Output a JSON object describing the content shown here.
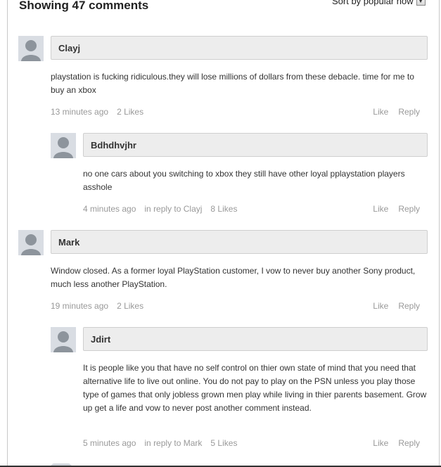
{
  "header": {
    "title": "Showing 47 comments",
    "sort_label": "Sort by popular now",
    "sort_icon": "chevron-down-icon"
  },
  "comments": [
    {
      "author": "Clayj",
      "text": "playstation is fucking ridiculous.they will lose millions of dollars from these debacle. time for me to buy an xbox",
      "time": "13 minutes ago",
      "in_reply_to": "",
      "likes": "2 Likes",
      "like_label": "Like",
      "reply_label": "Reply"
    },
    {
      "author": "Bdhdhvjhr",
      "text": "no one cars about you switching to xbox they still have other loyal pplaystation players asshole",
      "time": "4 minutes ago",
      "in_reply_to": "in reply to Clayj",
      "likes": "8 Likes",
      "like_label": "Like",
      "reply_label": "Reply"
    },
    {
      "author": "Mark",
      "text": "Window closed. As a former loyal PlayStation customer, I vow to never buy another Sony product, much less another PlayStation.",
      "time": "19 minutes ago",
      "in_reply_to": "",
      "likes": "2 Likes",
      "like_label": "Like",
      "reply_label": "Reply"
    },
    {
      "author": "Jdirt",
      "text": "It is people like you that have no self control on thier own state of mind that you need that alternative life to live out online. You do not pay to play on the PSN unless you play those type of games that only jobless grown men play while living in thier parents basement. Grow up get a life and vow to never post another comment instead.",
      "time": "5 minutes ago",
      "in_reply_to": "in reply to Mark",
      "likes": "5 Likes",
      "like_label": "Like",
      "reply_label": "Reply"
    }
  ]
}
